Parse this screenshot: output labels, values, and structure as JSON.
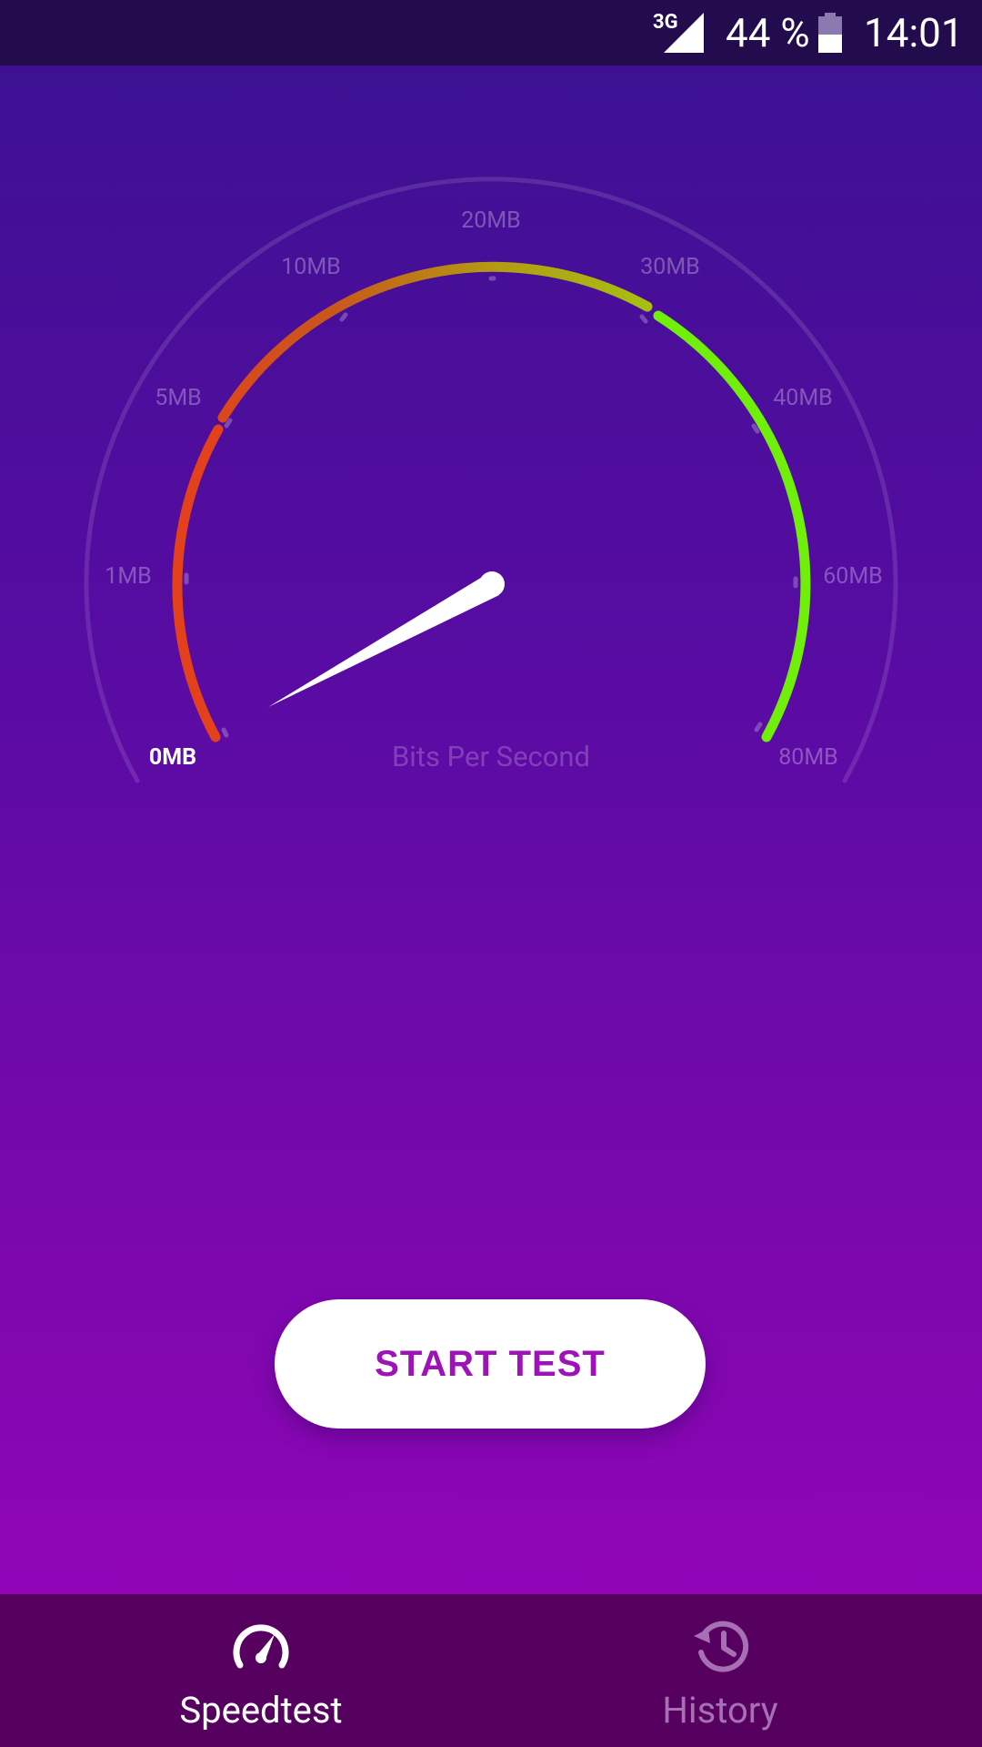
{
  "status_bar": {
    "network_type": "3G",
    "battery_percent": "44 %",
    "time": "14:01"
  },
  "gauge": {
    "tick_labels": [
      "0MB",
      "1MB",
      "5MB",
      "10MB",
      "20MB",
      "30MB",
      "40MB",
      "60MB",
      "80MB"
    ],
    "unit_label": "Bits Per Second",
    "current_value_fraction": 0.0,
    "arc_colors": [
      "#e2411c",
      "#c9571c",
      "#b39a12",
      "#a6c011",
      "#6fef0a"
    ]
  },
  "actions": {
    "start_label": "START TEST"
  },
  "bottom_nav": {
    "items": [
      {
        "label": "Speedtest",
        "icon": "speedometer-icon",
        "active": true
      },
      {
        "label": "History",
        "icon": "history-icon",
        "active": false
      }
    ]
  }
}
